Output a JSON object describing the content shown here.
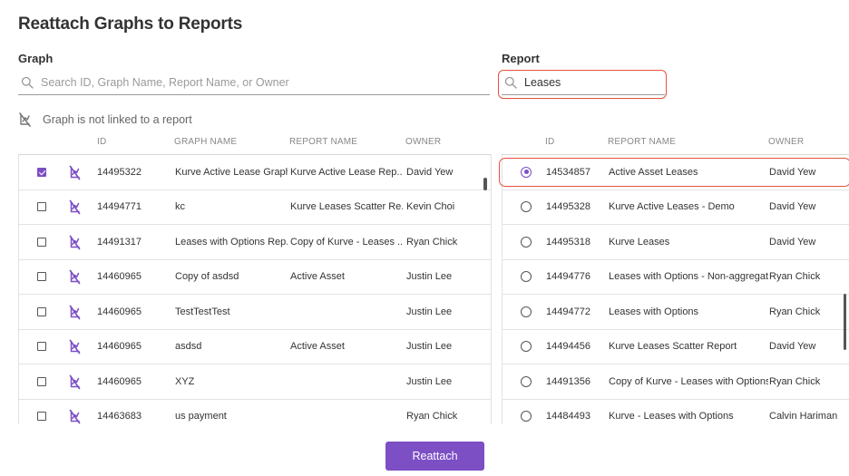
{
  "page": {
    "title": "Reattach Graphs to Reports"
  },
  "graph": {
    "label": "Graph",
    "search_placeholder": "Search ID, Graph Name, Report Name, or Owner",
    "legend_text": "Graph is not linked to a report",
    "columns": {
      "id": "ID",
      "graph_name": "GRAPH NAME",
      "report_name": "REPORT NAME",
      "owner": "OWNER"
    },
    "rows": [
      {
        "id": "14495322",
        "graph_name": "Kurve Active Lease Graph",
        "report_name": "Kurve Active Lease Rep...",
        "owner": "David Yew",
        "checked": true
      },
      {
        "id": "14494771",
        "graph_name": "kc",
        "report_name": "Kurve Leases Scatter Re...",
        "owner": "Kevin Choi",
        "checked": false
      },
      {
        "id": "14491317",
        "graph_name": "Leases with Options Rep...",
        "report_name": "Copy of Kurve - Leases ...",
        "owner": "Ryan Chick",
        "checked": false
      },
      {
        "id": "14460965",
        "graph_name": "Copy of asdsd",
        "report_name": "Active Asset",
        "owner": "Justin Lee",
        "checked": false
      },
      {
        "id": "14460965",
        "graph_name": "TestTestTest",
        "report_name": "",
        "owner": "Justin Lee",
        "checked": false
      },
      {
        "id": "14460965",
        "graph_name": "asdsd",
        "report_name": "Active Asset",
        "owner": "Justin Lee",
        "checked": false
      },
      {
        "id": "14460965",
        "graph_name": "XYZ",
        "report_name": "",
        "owner": "Justin Lee",
        "checked": false
      },
      {
        "id": "14463683",
        "graph_name": "us payment",
        "report_name": "",
        "owner": "Ryan Chick",
        "checked": false
      }
    ]
  },
  "report": {
    "label": "Report",
    "search_value": "Leases",
    "columns": {
      "id": "ID",
      "report_name": "REPORT NAME",
      "owner": "OWNER"
    },
    "rows": [
      {
        "id": "14534857",
        "report_name": "Active Asset Leases",
        "owner": "David Yew",
        "selected": true
      },
      {
        "id": "14495328",
        "report_name": "Kurve Active Leases - Demo",
        "owner": "David Yew",
        "selected": false
      },
      {
        "id": "14495318",
        "report_name": "Kurve Leases",
        "owner": "David Yew",
        "selected": false
      },
      {
        "id": "14494776",
        "report_name": "Leases with Options - Non-aggregate",
        "owner": "Ryan Chick",
        "selected": false
      },
      {
        "id": "14494772",
        "report_name": "Leases with Options",
        "owner": "Ryan Chick",
        "selected": false
      },
      {
        "id": "14494456",
        "report_name": "Kurve Leases Scatter Report",
        "owner": "David Yew",
        "selected": false
      },
      {
        "id": "14491356",
        "report_name": "Copy of Kurve - Leases with Options",
        "owner": "Ryan Chick",
        "selected": false
      },
      {
        "id": "14484493",
        "report_name": "Kurve - Leases with Options",
        "owner": "Calvin Hariman",
        "selected": false
      }
    ]
  },
  "actions": {
    "reattach_label": "Reattach"
  },
  "colors": {
    "accent": "#7c4fc4",
    "highlight": "#e5533d"
  },
  "icons": {
    "search": "search-icon",
    "unlink": "unlinked-graph-icon"
  }
}
